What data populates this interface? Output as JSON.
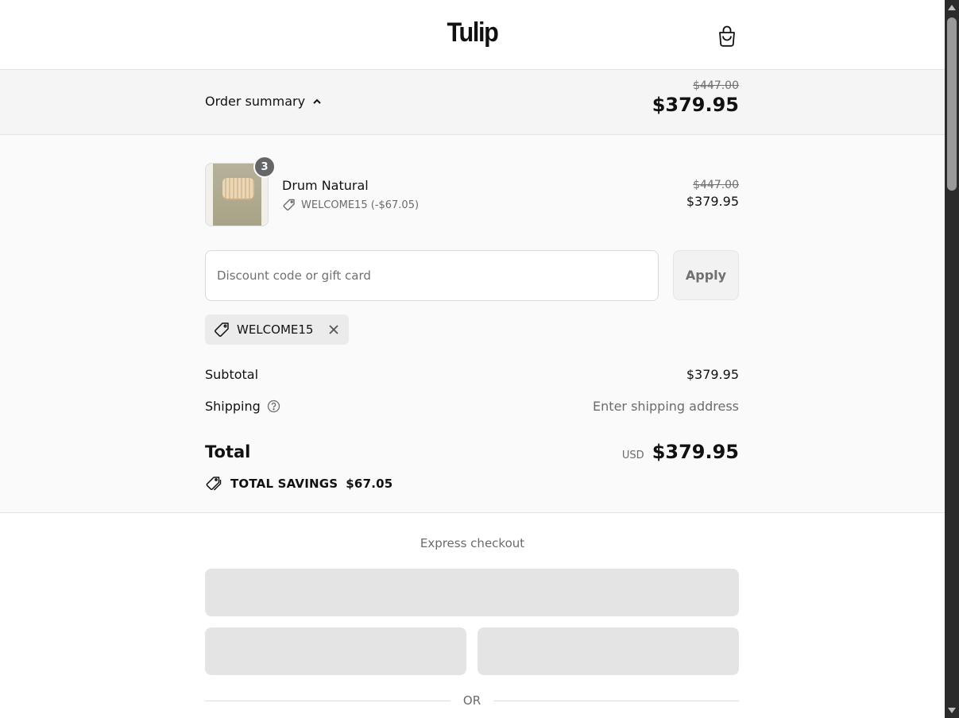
{
  "header": {
    "logo": "Tulip",
    "cart_icon": "shopping-bag-icon"
  },
  "summary_bar": {
    "toggle_label": "Order summary",
    "toggle_icon": "chevron-up-icon",
    "original_total": "$447.00",
    "total": "$379.95"
  },
  "line_item": {
    "quantity": "3",
    "name": "Drum Natural",
    "discount_icon": "tag-icon",
    "discount_text": "WELCOME15 (-$67.05)",
    "original_price": "$447.00",
    "price": "$379.95"
  },
  "discount": {
    "placeholder": "Discount code or gift card",
    "value": "",
    "apply_label": "Apply"
  },
  "applied_code": {
    "code": "WELCOME15",
    "icon": "tag-icon",
    "remove_icon": "close-icon"
  },
  "totals": {
    "subtotal_label": "Subtotal",
    "subtotal_value": "$379.95",
    "shipping_label": "Shipping",
    "shipping_help_icon": "question-circle-icon",
    "shipping_value": "Enter shipping address",
    "total_label": "Total",
    "currency": "USD",
    "total_value": "$379.95",
    "savings_icon": "tags-icon",
    "savings_label": "TOTAL SAVINGS",
    "savings_value": "$67.05"
  },
  "express": {
    "title": "Express checkout",
    "or_label": "OR"
  },
  "colors": {
    "summary_bg": "#f5f5f5",
    "order_bg": "#fafafa",
    "placeholder_button": "#e4e4e4",
    "qty_badge": "#666666"
  }
}
